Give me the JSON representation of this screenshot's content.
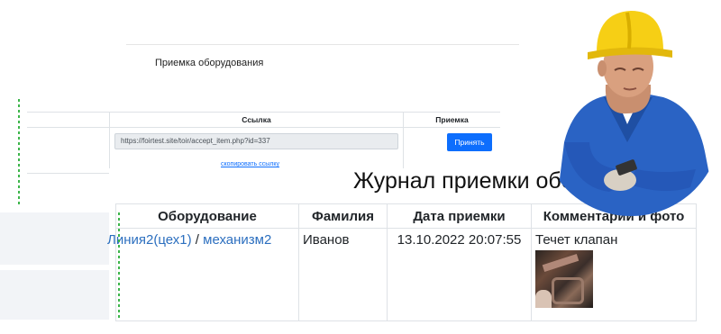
{
  "background_page": {
    "title": "Приемка оборудования",
    "columns": {
      "link": "Ссылка",
      "accept": "Приемка"
    },
    "url_value": "https://foirtest.site/toir/accept_item.php?id=337",
    "accept_button": "Принять",
    "copy_link": "скопировать ссылку"
  },
  "journal": {
    "title": "Журнал приемки оборудования",
    "headers": [
      "Оборудование",
      "Фамилия",
      "Дата приемки",
      "Комментарий и фото"
    ],
    "rows": [
      {
        "equipment_line": "Линия2(цех1)",
        "separator": " / ",
        "equipment_item": "механизм2",
        "surname": "Иванов",
        "date": "13.10.2022 20:07:55",
        "comment": "Течет клапан"
      }
    ]
  },
  "colors": {
    "accent": "#0d6efd",
    "link": "#2c6fbf",
    "dots": "#3cb54a",
    "helmet": "#f6cf15",
    "jacket": "#2a63c4"
  }
}
